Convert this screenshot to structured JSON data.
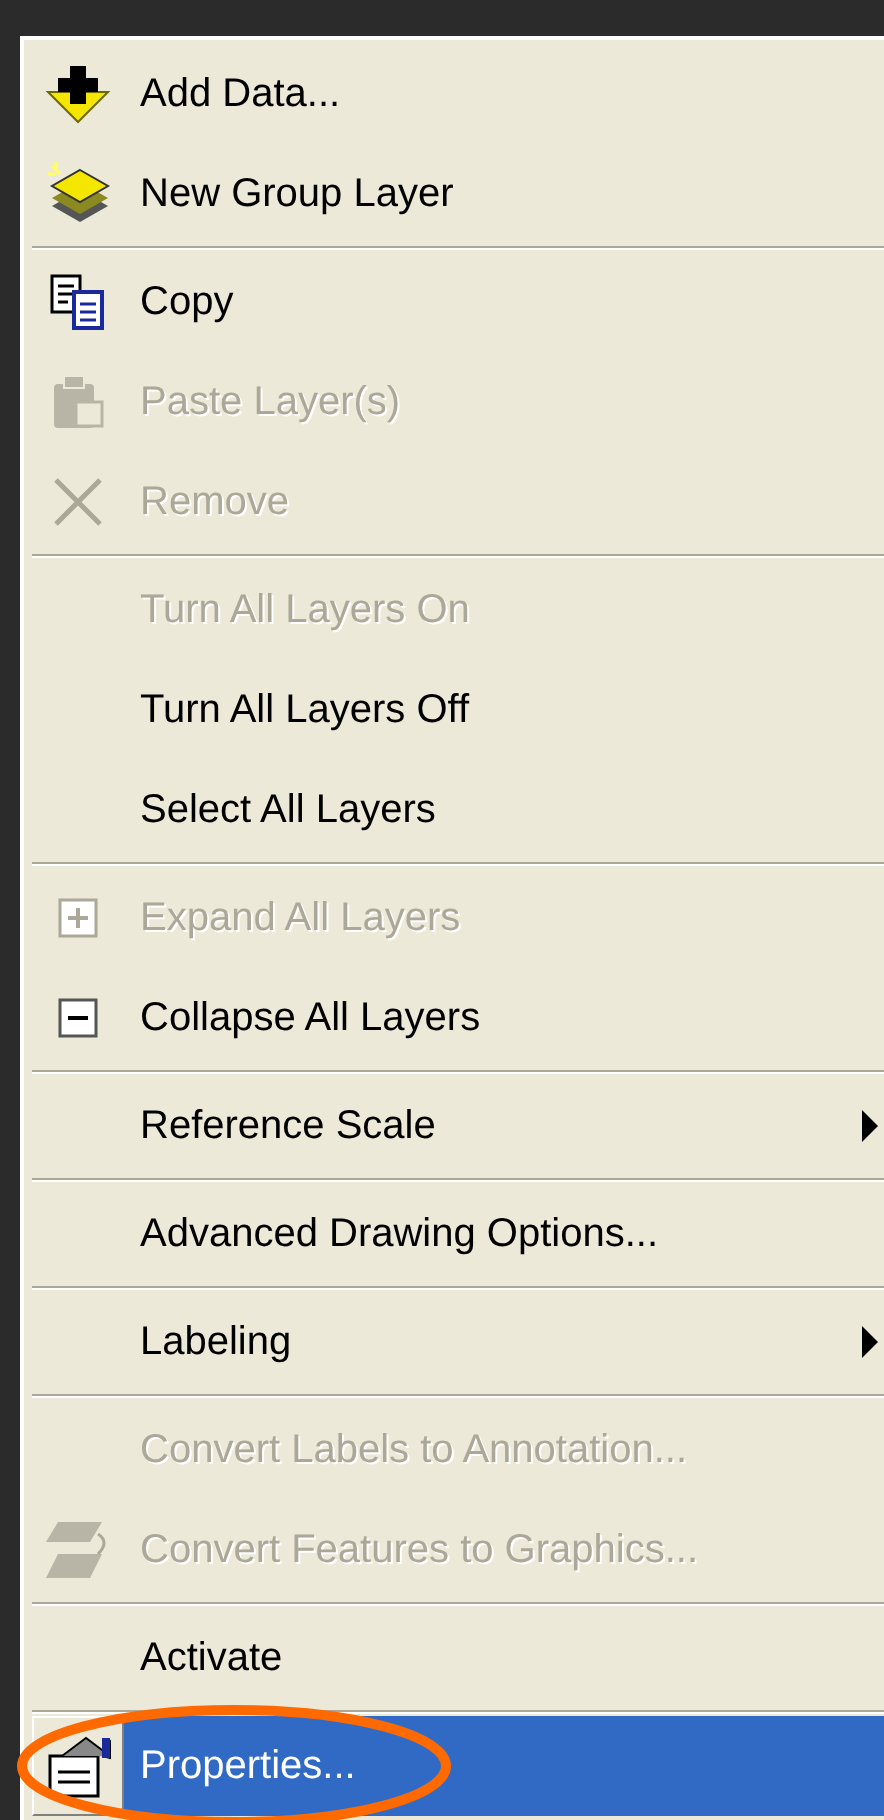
{
  "context_menu": {
    "groups": [
      [
        {
          "label": "Add Data...",
          "disabled": false,
          "selected": false,
          "submenu": false
        },
        {
          "label": "New Group Layer",
          "disabled": false,
          "selected": false,
          "submenu": false
        }
      ],
      [
        {
          "label": "Copy",
          "disabled": false,
          "selected": false,
          "submenu": false
        },
        {
          "label": "Paste Layer(s)",
          "disabled": true,
          "selected": false,
          "submenu": false
        },
        {
          "label": "Remove",
          "disabled": true,
          "selected": false,
          "submenu": false
        }
      ],
      [
        {
          "label": "Turn All Layers On",
          "disabled": true,
          "selected": false,
          "submenu": false
        },
        {
          "label": "Turn All Layers Off",
          "disabled": false,
          "selected": false,
          "submenu": false
        },
        {
          "label": "Select All Layers",
          "disabled": false,
          "selected": false,
          "submenu": false
        }
      ],
      [
        {
          "label": "Expand All Layers",
          "disabled": true,
          "selected": false,
          "submenu": false
        },
        {
          "label": "Collapse All Layers",
          "disabled": false,
          "selected": false,
          "submenu": false
        }
      ],
      [
        {
          "label": "Reference Scale",
          "disabled": false,
          "selected": false,
          "submenu": true
        }
      ],
      [
        {
          "label": "Advanced Drawing Options...",
          "disabled": false,
          "selected": false,
          "submenu": false
        }
      ],
      [
        {
          "label": "Labeling",
          "disabled": false,
          "selected": false,
          "submenu": true
        }
      ],
      [
        {
          "label": "Convert Labels to Annotation...",
          "disabled": true,
          "selected": false,
          "submenu": false
        },
        {
          "label": "Convert Features to Graphics...",
          "disabled": true,
          "selected": false,
          "submenu": false
        }
      ],
      [
        {
          "label": "Activate",
          "disabled": false,
          "selected": false,
          "submenu": false
        }
      ],
      [
        {
          "label": "Properties...",
          "disabled": false,
          "selected": true,
          "submenu": false
        }
      ]
    ]
  }
}
